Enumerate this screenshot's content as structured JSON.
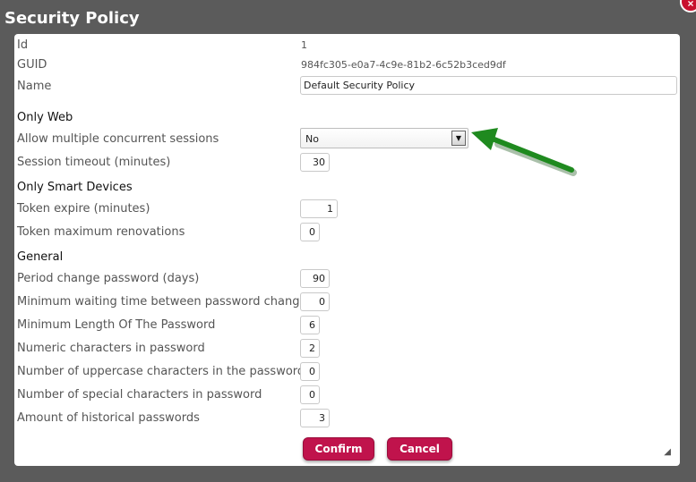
{
  "dialog": {
    "title": "Security Policy",
    "close_label": "×"
  },
  "fields": {
    "id": {
      "label": "Id",
      "value": "1"
    },
    "guid": {
      "label": "GUID",
      "value": "984fc305-e0a7-4c9e-81b2-6c52b3ced9df"
    },
    "name": {
      "label": "Name",
      "value": "Default Security Policy"
    }
  },
  "sections": {
    "only_web": "Only Web",
    "only_smart_devices": "Only Smart Devices",
    "general": "General"
  },
  "only_web": {
    "allow_multiple_sessions": {
      "label": "Allow multiple concurrent sessions",
      "value": "No"
    },
    "session_timeout": {
      "label": "Session timeout (minutes)",
      "value": "30"
    }
  },
  "only_smart_devices": {
    "token_expire": {
      "label": "Token expire (minutes)",
      "value": "1"
    },
    "token_max_renovations": {
      "label": "Token maximum renovations",
      "value": "0"
    }
  },
  "general": {
    "period_change_password": {
      "label": "Period change password (days)",
      "value": "90"
    },
    "min_waiting_time": {
      "label": "Minimum waiting time between password changes",
      "value": "0"
    },
    "min_length": {
      "label": "Minimum Length Of The Password",
      "value": "6"
    },
    "numeric_chars": {
      "label": "Numeric characters in password",
      "value": "2"
    },
    "uppercase_chars": {
      "label": "Number of uppercase characters in the password",
      "value": "0"
    },
    "special_chars": {
      "label": "Number of special characters in password",
      "value": "0"
    },
    "historical_passwords": {
      "label": "Amount of historical passwords",
      "value": "3"
    }
  },
  "buttons": {
    "confirm": "Confirm",
    "cancel": "Cancel"
  },
  "colors": {
    "overlay": "#5b5b5b",
    "button": "#c0134c",
    "annotation_arrow": "#1f8a1f"
  },
  "icons": {
    "close": "close-icon",
    "dropdown": "chevron-down-icon",
    "resize": "resize-grip-icon",
    "annotation": "green-arrow-annotation"
  }
}
